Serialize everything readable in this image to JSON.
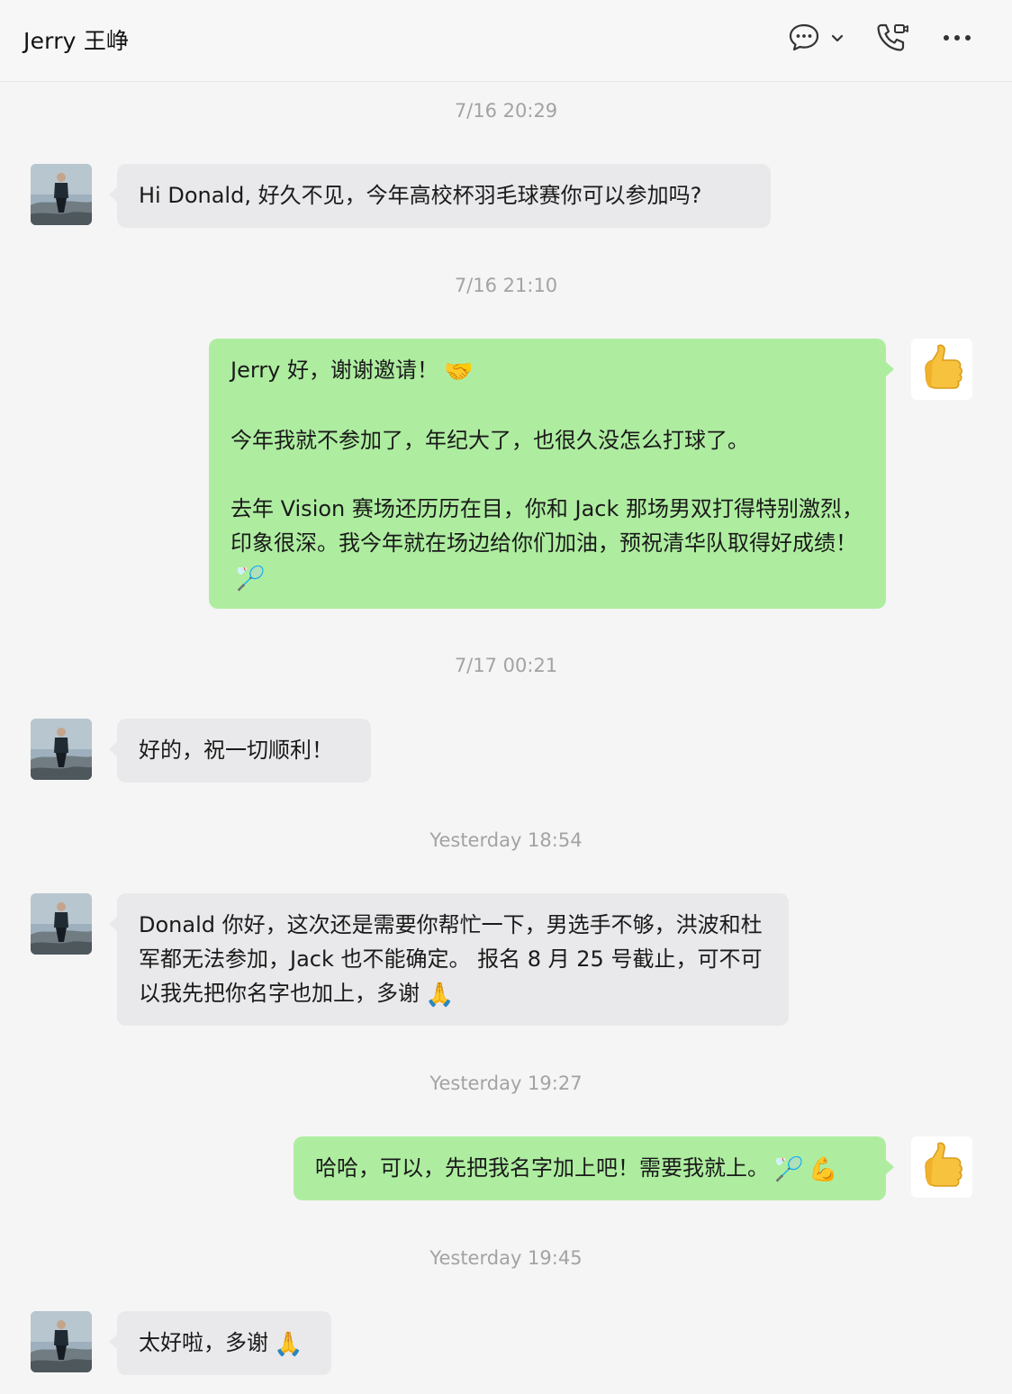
{
  "header": {
    "contact_name": "Jerry 王峥",
    "icons": [
      "chat-bubble-icon",
      "chevron-down-icon",
      "phone-video-icon",
      "more-icon"
    ]
  },
  "messages": [
    {
      "timestamp": "7/16 20:29",
      "direction": "incoming",
      "paragraphs": [
        "Hi Donald, 好久不见，今年高校杯羽毛球赛你可以参加吗?"
      ]
    },
    {
      "timestamp": "7/16 21:10",
      "direction": "outgoing",
      "paragraphs": [
        "Jerry 好，谢谢邀请！",
        "今年我就不参加了，年纪大了，也很久没怎么打球了。",
        "去年 Vision 赛场还历历在目，你和 Jack 那场男双打得特别激烈，印象很深。我今年就在场边给你们加油，预祝清华队取得好成绩！"
      ],
      "emojis": [
        "🤝",
        "🏸"
      ]
    },
    {
      "timestamp": "7/17 00:21",
      "direction": "incoming",
      "paragraphs": [
        "好的，祝一切顺利！"
      ]
    },
    {
      "timestamp": "Yesterday 18:54",
      "direction": "incoming",
      "paragraphs": [
        "Donald 你好，这次还是需要你帮忙一下，男选手不够，洪波和杜军都无法参加，Jack 也不能确定。 报名 8 月 25 号截止，可不可以我先把你名字也加上，多谢"
      ],
      "emojis": [
        "🙏"
      ]
    },
    {
      "timestamp": "Yesterday 19:27",
      "direction": "outgoing",
      "paragraphs": [
        "哈哈，可以，先把我名字加上吧！需要我就上。"
      ],
      "emojis": [
        "🏸",
        "💪"
      ]
    },
    {
      "timestamp": "Yesterday 19:45",
      "direction": "incoming",
      "paragraphs": [
        "太好啦，多谢"
      ],
      "emojis": [
        "🙏"
      ]
    }
  ],
  "colors": {
    "incoming_bubble": "#e9e9eb",
    "outgoing_bubble": "#aeeda0",
    "background": "#f5f5f5",
    "timestamp_text": "#a3a3a3"
  }
}
